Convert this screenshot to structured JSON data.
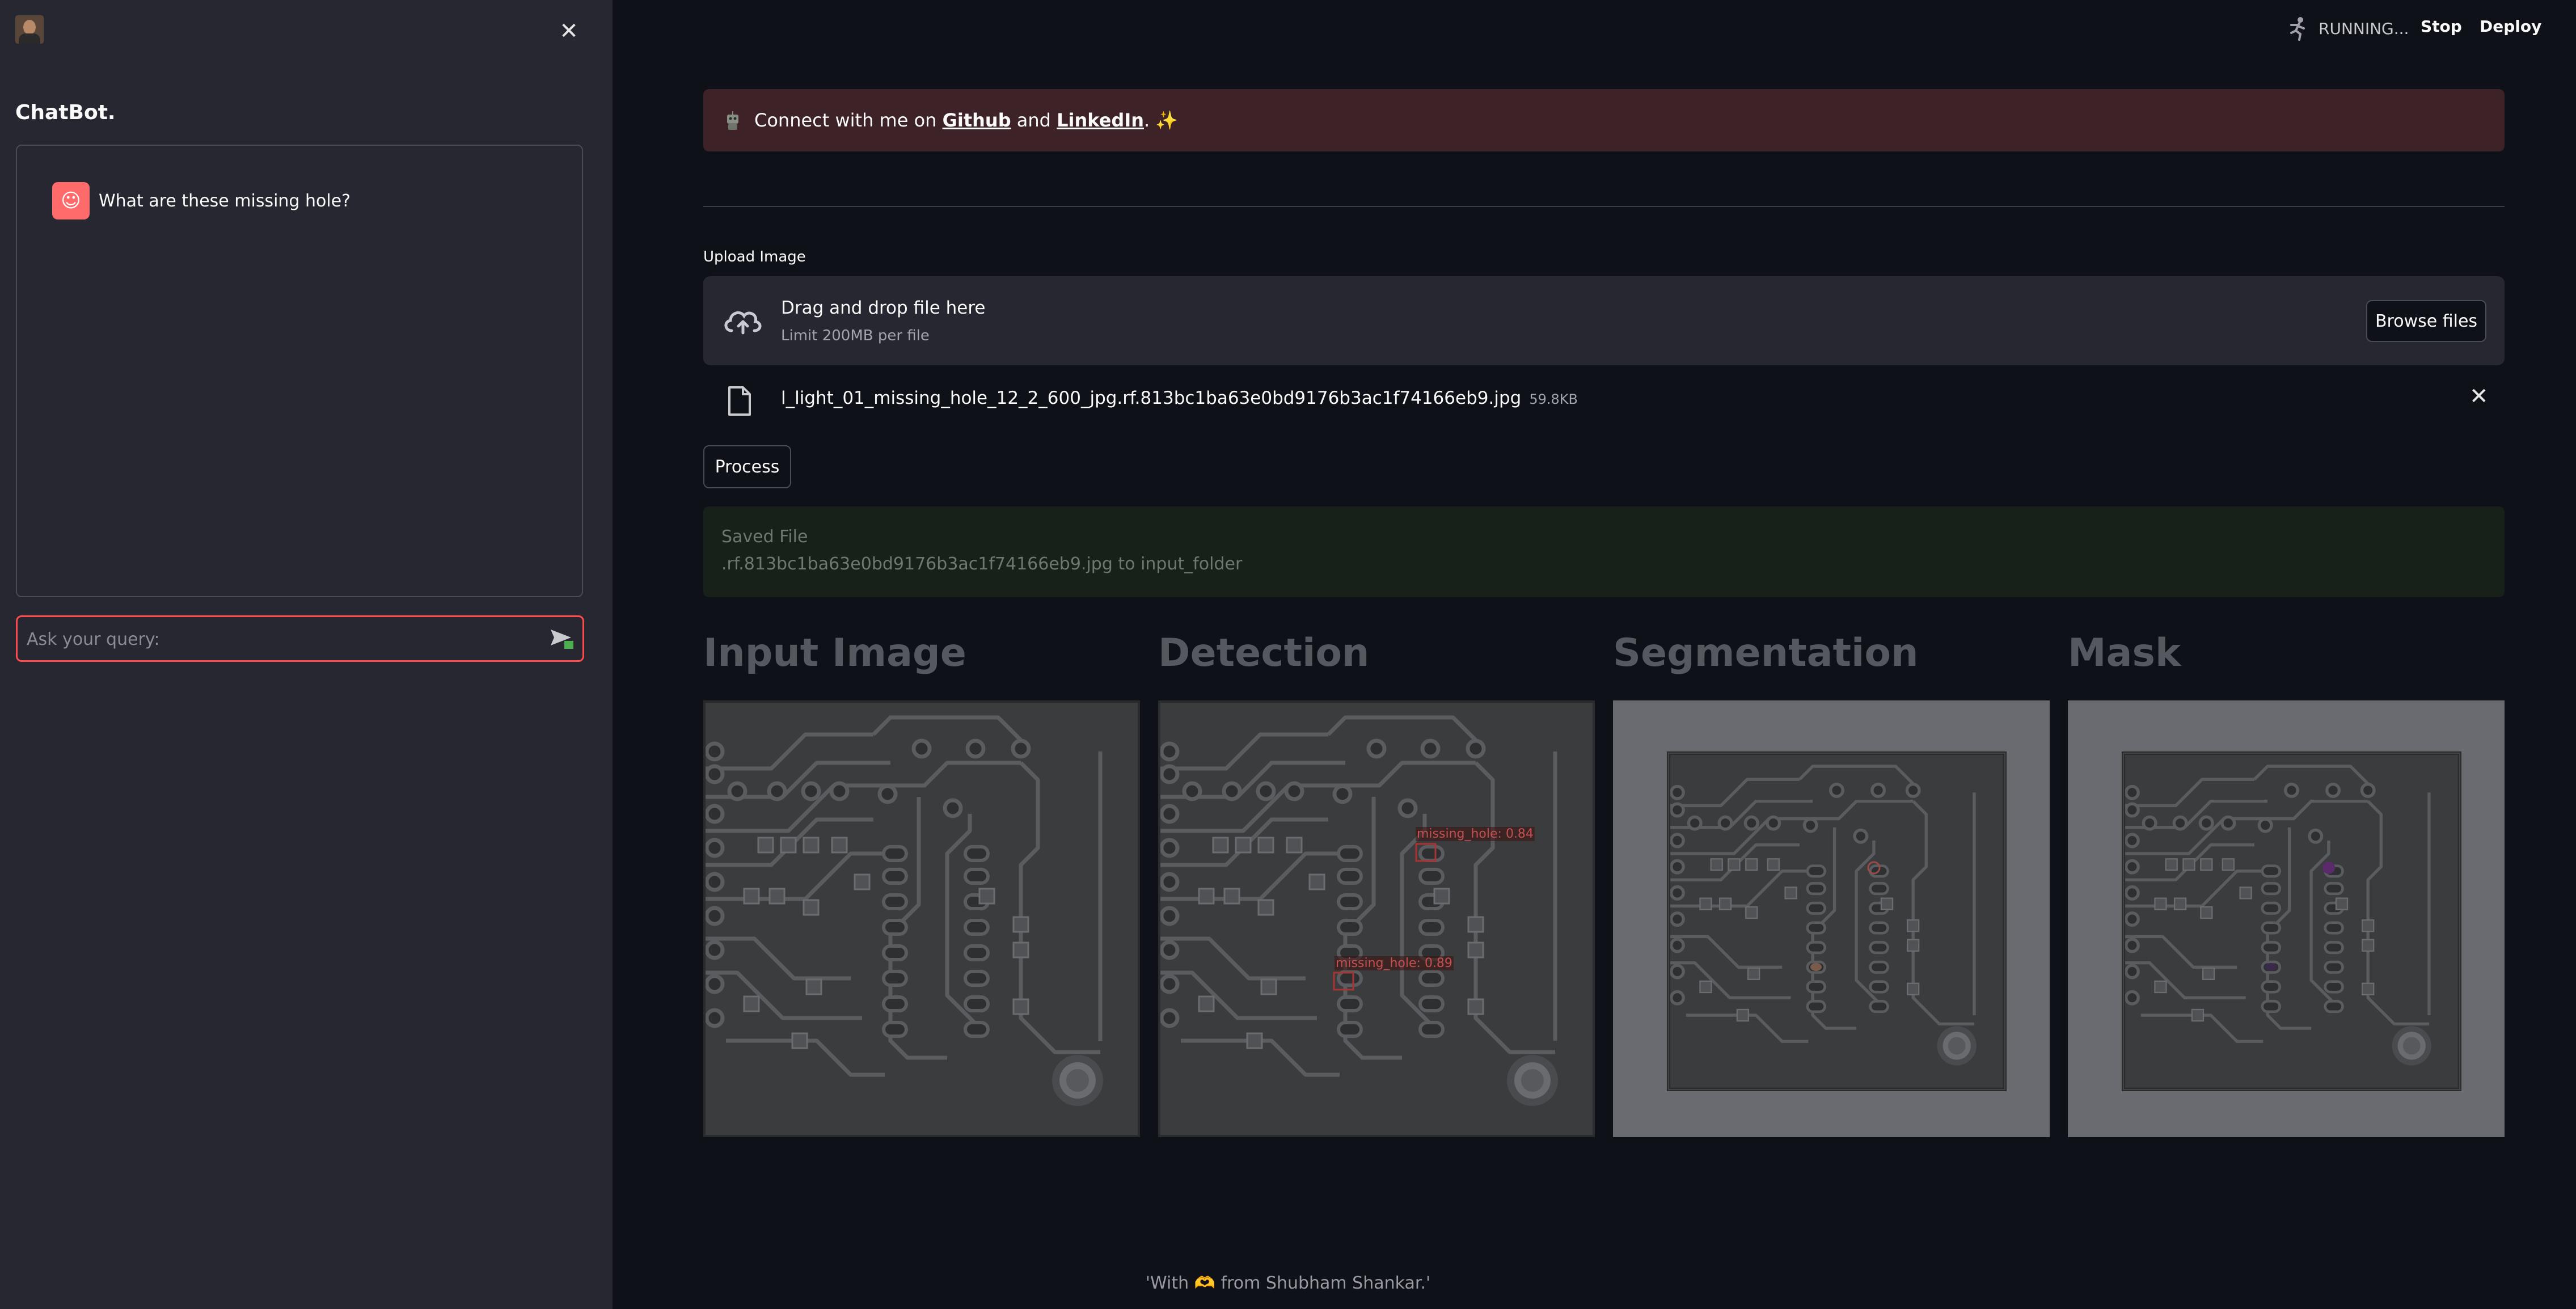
{
  "sidebar": {
    "title": "ChatBot.",
    "messages": [
      {
        "text": "What are these missing hole?"
      }
    ],
    "input_placeholder": "Ask your query:"
  },
  "topbar": {
    "status": "RUNNING...",
    "stop_label": "Stop",
    "deploy_label": "Deploy"
  },
  "banner": {
    "prefix": "Connect with me on ",
    "github": "Github",
    "and": " and ",
    "linkedin": "LinkedIn",
    "suffix": ". ✨"
  },
  "uploader": {
    "label": "Upload Image",
    "drop_title": "Drag and drop file here",
    "limit": "Limit 200MB per file",
    "browse_label": "Browse files",
    "file_name": "l_light_01_missing_hole_12_2_600_jpg.rf.813bc1ba63e0bd9176b3ac1f74166eb9.jpg",
    "file_size": "59.8KB"
  },
  "process_label": "Process",
  "saved": {
    "line1": "Saved File",
    "line2": ".rf.813bc1ba63e0bd9176b3ac1f74166eb9.jpg to input_folder"
  },
  "columns": {
    "input": "Input Image",
    "detection": "Detection",
    "segmentation": "Segmentation",
    "mask": "Mask"
  },
  "detections": [
    {
      "label": "missing_hole: 0.84"
    },
    {
      "label": "missing_hole: 0.89"
    }
  ],
  "footer": "'With 🫶 from Shubham Shankar.'",
  "colors": {
    "accent": "#ff4b4b",
    "sidebar_bg": "#262730",
    "main_bg": "#0e1117",
    "banner_bg": "#3d2227",
    "success_bg": "#172119"
  }
}
